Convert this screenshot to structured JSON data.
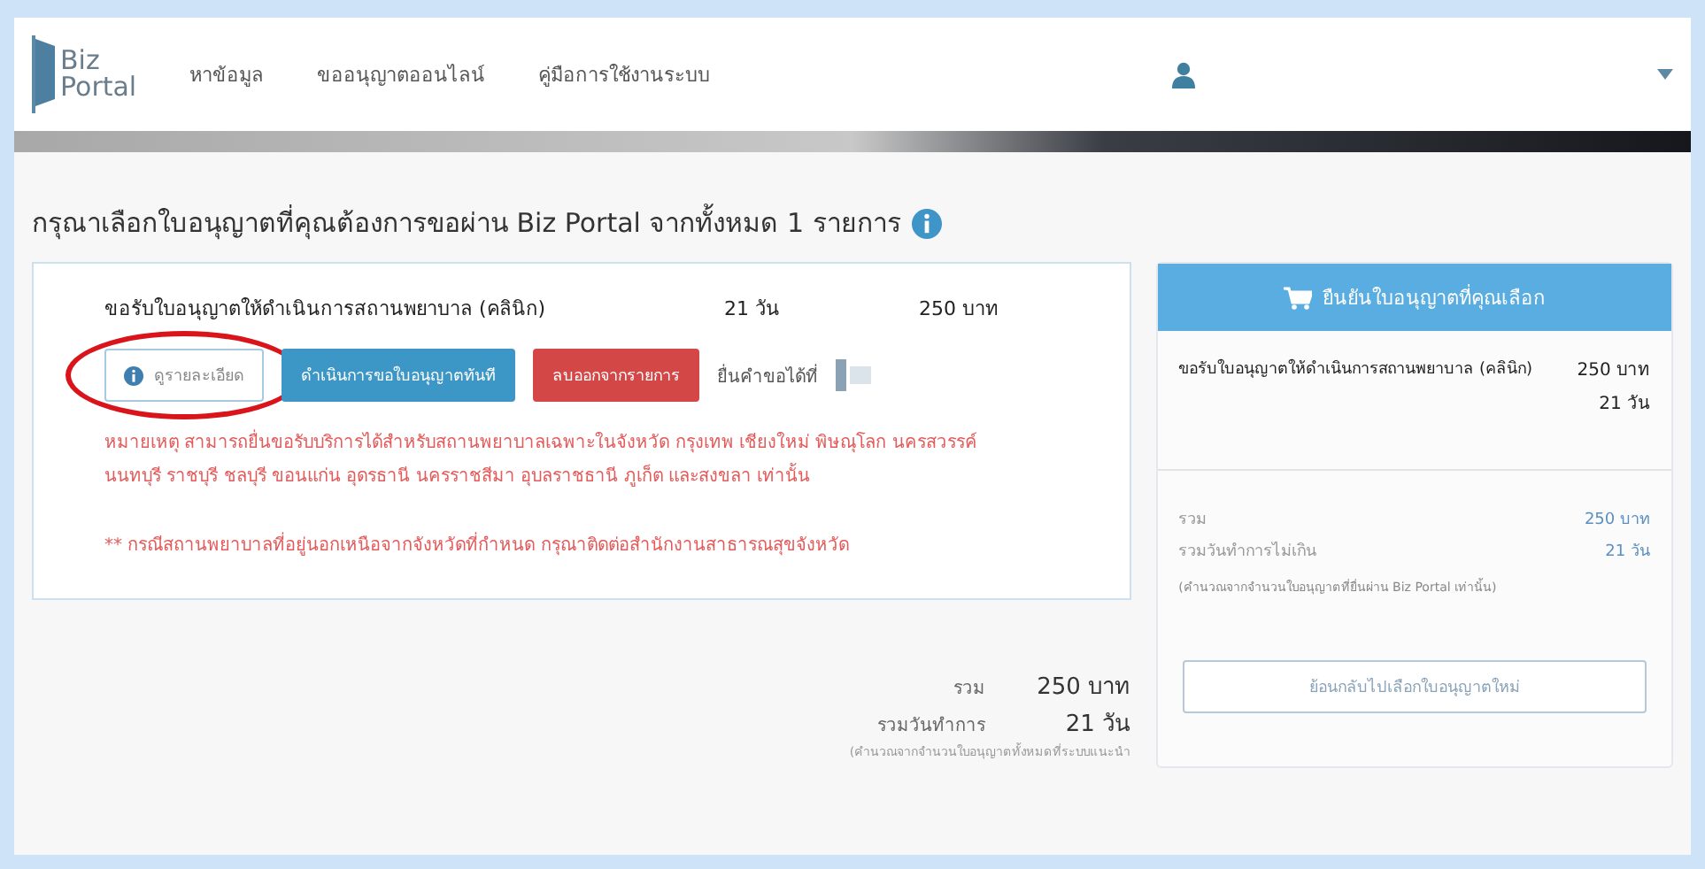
{
  "nav": {
    "logo_top": "Biz",
    "logo_bottom": "Portal",
    "links": [
      "หาข้อมูล",
      "ขออนุญาตออนไลน์",
      "คู่มือการใช้งานระบบ"
    ]
  },
  "heading": "กรุณาเลือกใบอนุญาตที่คุณต้องการขอผ่าน Biz Portal จากทั้งหมด 1 รายการ",
  "license": {
    "name": "ขอรับใบอนุญาตให้ดำเนินการสถานพยาบาล (คลินิก)",
    "days": "21 วัน",
    "fee": "250 บาท",
    "buttons": [
      {
        "kind": "outline",
        "label": "ดูรายละเอียด",
        "highlighted": true
      },
      {
        "kind": "primary",
        "label": "ดำเนินการขอใบอนุญาตทันที",
        "highlighted": false
      },
      {
        "kind": "danger",
        "label": "ลบออกจากรายการ",
        "highlighted": false
      }
    ],
    "submit_at": "ยื่นคำขอได้ที่",
    "notes": [
      "หมายเหตุ สามารถยื่นขอรับบริการได้สำหรับสถานพยาบาลเฉพาะในจังหวัด กรุงเทพ เชียงใหม่ พิษณุโลก นครสวรรค์ นนทบุรี ราชบุรี ชลบุรี ขอนแก่น อุดรธานี นครราชสีมา อุบลราชธานี ภูเก็ต และสงขลา เท่านั้น",
      "** กรณีสถานพยาบาลที่อยู่นอกเหนือจากจังหวัดที่กำหนด กรุณาติดต่อสำนักงานสาธารณสุขจังหวัด"
    ]
  },
  "totals": {
    "sum_label": "รวม",
    "sum": "250 บาท",
    "days_label": "รวมวันทำการ",
    "days": "21 วัน",
    "note": "(คำนวณจากจำนวนใบอนุญาตทั้งหมดที่ระบบแนะนำ"
  },
  "cart": {
    "title": "ยืนยันใบอนุญาตที่คุณเลือก",
    "item": "ขอรับใบอนุญาตให้ดำเนินการสถานพยาบาล (คลินิก)",
    "item_fee": "250 บาท",
    "item_days": "21 วัน",
    "sum_label": "รวม",
    "sum": "250 บาท",
    "days_label": "รวมวันทำการไม่เกิน",
    "days": "21 วัน",
    "note": "(คำนวณจากจำนวนใบอนุญาตที่ยื่นผ่าน Biz Portal เท่านั้น)",
    "back_button": "ย้อนกลับไปเลือกใบอนุญาตใหม่"
  }
}
